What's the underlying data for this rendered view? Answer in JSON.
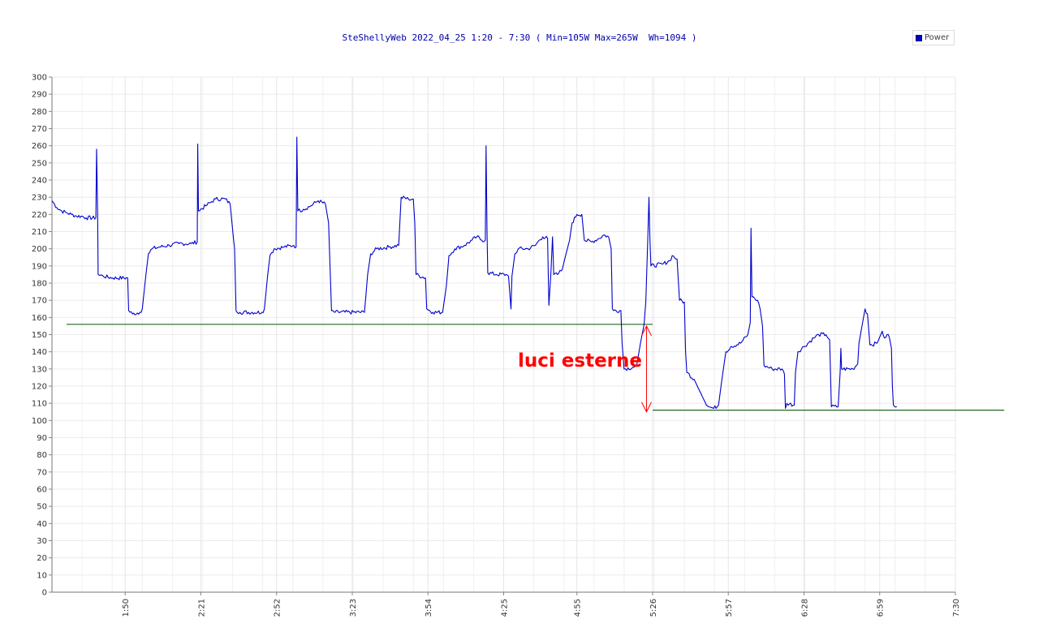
{
  "chart_data": {
    "type": "line",
    "title": "SteShellyWeb 2022_04_25 1:20 - 7:30 ( Min=105W Max=265W  Wh=1094 )",
    "xlabel": "",
    "ylabel": "",
    "xlim": [
      80,
      450
    ],
    "ylim": [
      0,
      300
    ],
    "y_ticks": [
      0,
      10,
      20,
      30,
      40,
      50,
      60,
      70,
      80,
      90,
      100,
      110,
      120,
      130,
      140,
      150,
      160,
      170,
      180,
      190,
      200,
      210,
      220,
      230,
      240,
      250,
      260,
      270,
      280,
      290,
      300
    ],
    "x_ticks": [
      {
        "label": "1:50",
        "value": 110
      },
      {
        "label": "2:21",
        "value": 141
      },
      {
        "label": "2:52",
        "value": 172
      },
      {
        "label": "3:23",
        "value": 203
      },
      {
        "label": "3:54",
        "value": 234
      },
      {
        "label": "4:25",
        "value": 265
      },
      {
        "label": "4:55",
        "value": 295
      },
      {
        "label": "5:26",
        "value": 326
      },
      {
        "label": "5:57",
        "value": 357
      },
      {
        "label": "6:28",
        "value": 388
      },
      {
        "label": "6:59",
        "value": 419
      },
      {
        "label": "7:30",
        "value": 450
      }
    ],
    "grid": true,
    "legend": {
      "position": "top-right",
      "entries": [
        {
          "name": "Power",
          "color": "#0000cc"
        }
      ]
    },
    "series": [
      {
        "name": "Power",
        "color": "#0000cc",
        "points": [
          [
            80,
            228
          ],
          [
            82,
            224
          ],
          [
            84,
            222
          ],
          [
            86,
            221
          ],
          [
            88,
            220
          ],
          [
            90,
            219
          ],
          [
            92,
            219
          ],
          [
            94,
            218
          ],
          [
            98,
            218
          ],
          [
            98.3,
            258
          ],
          [
            98.7,
            220
          ],
          [
            98.9,
            185
          ],
          [
            101,
            184
          ],
          [
            105,
            183
          ],
          [
            111,
            183
          ],
          [
            111.4,
            164
          ],
          [
            113,
            162
          ],
          [
            116,
            163
          ],
          [
            117,
            165
          ],
          [
            118.5,
            185
          ],
          [
            119.5,
            197
          ],
          [
            121,
            200
          ],
          [
            124,
            201
          ],
          [
            128,
            202
          ],
          [
            132,
            203
          ],
          [
            137,
            203
          ],
          [
            139.5,
            204
          ],
          [
            139.7,
            261
          ],
          [
            140,
            222
          ],
          [
            143,
            225
          ],
          [
            145,
            227
          ],
          [
            147,
            229
          ],
          [
            151,
            229
          ],
          [
            153,
            226
          ],
          [
            154.4,
            205
          ],
          [
            154.8,
            200
          ],
          [
            155.4,
            164
          ],
          [
            157,
            163
          ],
          [
            166,
            163
          ],
          [
            167,
            165
          ],
          [
            168.3,
            184
          ],
          [
            169.3,
            196
          ],
          [
            171,
            200
          ],
          [
            175,
            201
          ],
          [
            179,
            202
          ],
          [
            180,
            201
          ],
          [
            180.3,
            265
          ],
          [
            180.7,
            222
          ],
          [
            183,
            223
          ],
          [
            186,
            225
          ],
          [
            189,
            228
          ],
          [
            192,
            226
          ],
          [
            193.3,
            215
          ],
          [
            194.5,
            164
          ],
          [
            196,
            163
          ],
          [
            208,
            163
          ],
          [
            209.3,
            185
          ],
          [
            210.5,
            197
          ],
          [
            213,
            200
          ],
          [
            218,
            201
          ],
          [
            222,
            202
          ],
          [
            223,
            230
          ],
          [
            226,
            229
          ],
          [
            228,
            229
          ],
          [
            228.6,
            215
          ],
          [
            229.1,
            185
          ],
          [
            233,
            183
          ],
          [
            233.5,
            165
          ],
          [
            236,
            163
          ],
          [
            240,
            163
          ],
          [
            241.5,
            178
          ],
          [
            242.6,
            196
          ],
          [
            245,
            200
          ],
          [
            249,
            202
          ],
          [
            252,
            205
          ],
          [
            254,
            207
          ],
          [
            256,
            205
          ],
          [
            257.5,
            205
          ],
          [
            257.8,
            260
          ],
          [
            258.2,
            210
          ],
          [
            258.5,
            186
          ],
          [
            262,
            185
          ],
          [
            266,
            185
          ],
          [
            267,
            184
          ],
          [
            268,
            165
          ],
          [
            268.4,
            184
          ],
          [
            269.6,
            197
          ],
          [
            271,
            200
          ],
          [
            275,
            200
          ],
          [
            278,
            202
          ],
          [
            279,
            204
          ],
          [
            281,
            207
          ],
          [
            283,
            206
          ],
          [
            283.5,
            167
          ],
          [
            284.3,
            185
          ],
          [
            285,
            207
          ],
          [
            285.5,
            185
          ],
          [
            287,
            185
          ],
          [
            289,
            188
          ],
          [
            290,
            194
          ],
          [
            292,
            205
          ],
          [
            293,
            215
          ],
          [
            295,
            220
          ],
          [
            297,
            220
          ],
          [
            298,
            205
          ],
          [
            301,
            204
          ],
          [
            304,
            206
          ],
          [
            306,
            208
          ],
          [
            308,
            207
          ],
          [
            309,
            200
          ],
          [
            309.5,
            165
          ],
          [
            310,
            164
          ],
          [
            313,
            164
          ],
          [
            313.5,
            145
          ],
          [
            314.3,
            130
          ],
          [
            318,
            131
          ],
          [
            319.5,
            132
          ],
          [
            321,
            145
          ],
          [
            322.5,
            156
          ],
          [
            323.2,
            169
          ],
          [
            324,
            205
          ],
          [
            324.5,
            230
          ],
          [
            324.9,
            205
          ],
          [
            325.3,
            190
          ],
          [
            330,
            191
          ],
          [
            333,
            193
          ],
          [
            334,
            196
          ],
          [
            336,
            194
          ],
          [
            337,
            170
          ],
          [
            339,
            169
          ],
          [
            339.5,
            140
          ],
          [
            340,
            128
          ],
          [
            343,
            124
          ],
          [
            345,
            118
          ],
          [
            347,
            112
          ],
          [
            349,
            108
          ],
          [
            351,
            107
          ],
          [
            353,
            109
          ],
          [
            354.5,
            125
          ],
          [
            356,
            140
          ],
          [
            358,
            143
          ],
          [
            362,
            145
          ],
          [
            365,
            150
          ],
          [
            366,
            157
          ],
          [
            366.3,
            212
          ],
          [
            366.7,
            172
          ],
          [
            369,
            170
          ],
          [
            370,
            165
          ],
          [
            371,
            155
          ],
          [
            371.6,
            132
          ],
          [
            375,
            130
          ],
          [
            379,
            130
          ],
          [
            380,
            127
          ],
          [
            380.4,
            107
          ],
          [
            381,
            110
          ],
          [
            384,
            109
          ],
          [
            384.5,
            128
          ],
          [
            385.5,
            140
          ],
          [
            388,
            143
          ],
          [
            392,
            148
          ],
          [
            394,
            150
          ],
          [
            397,
            150
          ],
          [
            398.5,
            147
          ],
          [
            398.8,
            130
          ],
          [
            399.2,
            108
          ],
          [
            402,
            108
          ],
          [
            402.8,
            128
          ],
          [
            403.1,
            142
          ],
          [
            403.4,
            130
          ],
          [
            408,
            130
          ],
          [
            410,
            133
          ],
          [
            410.5,
            145
          ],
          [
            412,
            157
          ],
          [
            413,
            165
          ],
          [
            414,
            162
          ],
          [
            415,
            144
          ],
          [
            418,
            145
          ],
          [
            420,
            152
          ],
          [
            421,
            148
          ],
          [
            422,
            150
          ],
          [
            423,
            148
          ],
          [
            423.8,
            142
          ],
          [
            424.2,
            120
          ],
          [
            424.6,
            109
          ],
          [
            426,
            108
          ]
        ]
      }
    ],
    "reference_lines": [
      {
        "y": 156,
        "x_start": 86,
        "x_end": 326,
        "color": "#226622"
      },
      {
        "y": 106,
        "x_start": 326,
        "x_end": 470,
        "color": "#226622"
      }
    ],
    "annotations": [
      {
        "text": "luci esterne",
        "color": "#ff0000"
      }
    ],
    "arrow": {
      "x": 323.5,
      "y1": 105,
      "y2": 155,
      "color": "#ff0000"
    }
  }
}
